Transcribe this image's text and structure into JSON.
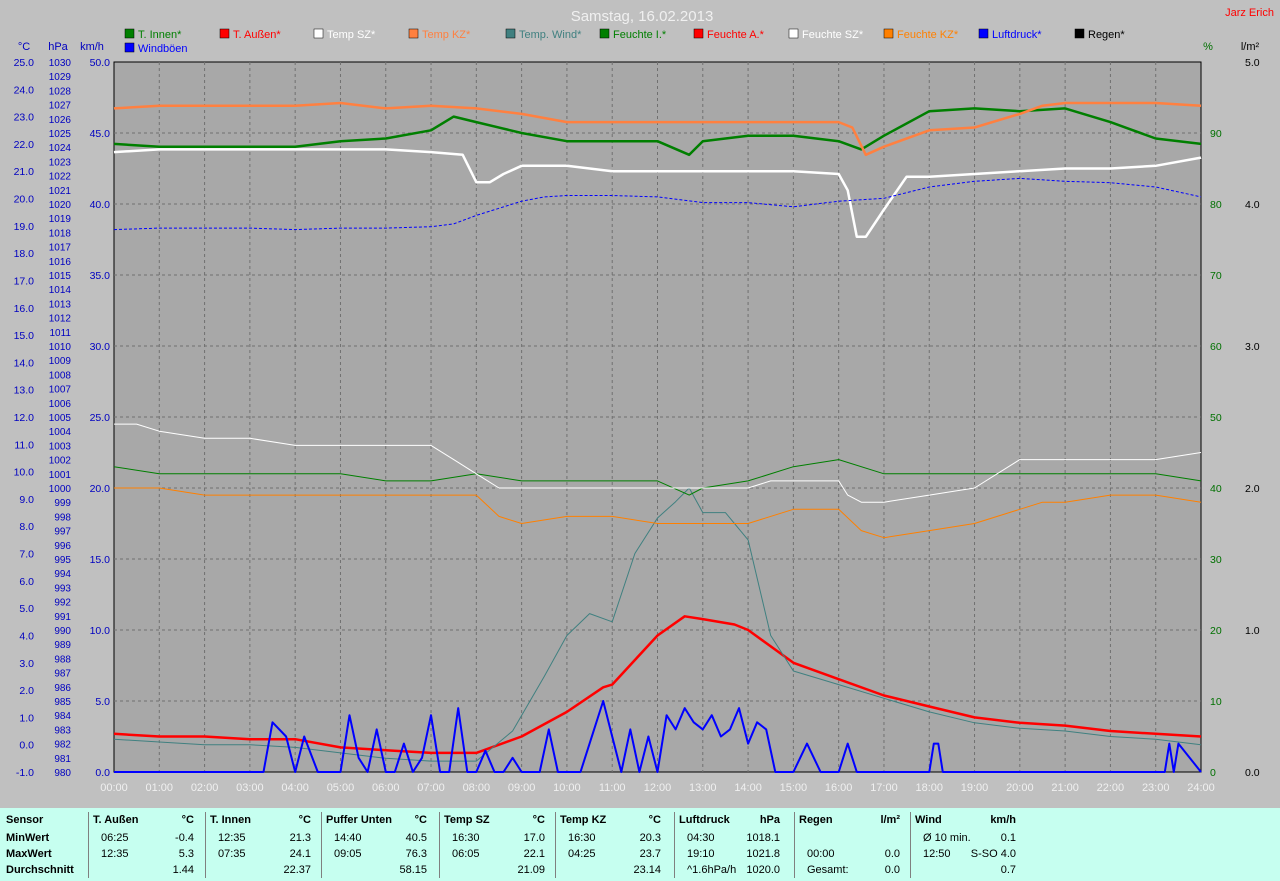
{
  "title": "Samstag, 16.02.2013",
  "author": "Jarz Erich",
  "legend": [
    {
      "label": "T. Innen*",
      "color": "#007f00"
    },
    {
      "label": "T. Außen*",
      "color": "#ff0000"
    },
    {
      "label": "Temp SZ*",
      "color": "#ffffff"
    },
    {
      "label": "Temp KZ*",
      "color": "#ff8040"
    },
    {
      "label": "Temp. Wind*",
      "color": "#408080"
    },
    {
      "label": "Feuchte I.*",
      "color": "#007f00"
    },
    {
      "label": "Feuchte A.*",
      "color": "#ff0000"
    },
    {
      "label": "Feuchte SZ*",
      "color": "#ffffff"
    },
    {
      "label": "Feuchte KZ*",
      "color": "#ff8000"
    },
    {
      "label": "Luftdruck*",
      "color": "#0000ff"
    },
    {
      "label": "Regen*",
      "color": "#000000"
    },
    {
      "label": "Windböen",
      "color": "#0000ff"
    }
  ],
  "axis_units": {
    "temp": "°C",
    "pressure": "hPa",
    "wind": "km/h",
    "humidity": "%",
    "rain": "l/m²"
  },
  "chart_data": {
    "type": "line",
    "x_ticks": [
      "00:00",
      "01:00",
      "02:00",
      "03:00",
      "04:00",
      "05:00",
      "06:00",
      "07:00",
      "08:00",
      "09:00",
      "10:00",
      "11:00",
      "12:00",
      "13:00",
      "14:00",
      "15:00",
      "16:00",
      "17:00",
      "18:00",
      "19:00",
      "20:00",
      "21:00",
      "22:00",
      "23:00",
      "24:00"
    ],
    "temp_axis": {
      "min": -1.0,
      "max": 25.0,
      "step": 1.0
    },
    "pressure_axis": {
      "min": 980,
      "max": 1030,
      "step": 1
    },
    "wind_axis": {
      "min": 0.0,
      "max": 50.0,
      "step": 5.0
    },
    "humidity_axis": {
      "min": 0,
      "max": 100,
      "step": 10
    },
    "rain_axis": {
      "min": 0.0,
      "max": 5.0,
      "step": 1.0
    },
    "grid": true,
    "series": [
      {
        "name": "T. Außen",
        "axis": "temp",
        "color": "#ff0000",
        "width": 2.5,
        "x": [
          0,
          1,
          2,
          3,
          4,
          5,
          6,
          7,
          8,
          9,
          10,
          10.8,
          11,
          11.5,
          12,
          12.6,
          13,
          13.7,
          14,
          15,
          16,
          17,
          18,
          19,
          20,
          21,
          22,
          23,
          24
        ],
        "y": [
          0.4,
          0.3,
          0.3,
          0.2,
          0.2,
          -0.1,
          -0.2,
          -0.3,
          -0.3,
          0.3,
          1.2,
          2.1,
          2.2,
          3.1,
          4.0,
          4.7,
          4.6,
          4.4,
          4.2,
          3.0,
          2.4,
          1.8,
          1.4,
          1.0,
          0.8,
          0.7,
          0.5,
          0.4,
          0.3
        ]
      },
      {
        "name": "Temp. Wind",
        "axis": "temp",
        "color": "#408080",
        "width": 1,
        "x": [
          0,
          1,
          2,
          3,
          4,
          5,
          6,
          7,
          8,
          8.8,
          9.5,
          10,
          10.5,
          11,
          11.5,
          12,
          12.4,
          12.7,
          13,
          13.5,
          14,
          14.5,
          15,
          16,
          17,
          18,
          19,
          20,
          21,
          22,
          23,
          24
        ],
        "y": [
          0.2,
          0.1,
          0.0,
          0.0,
          -0.1,
          -0.3,
          -0.5,
          -0.6,
          -0.6,
          0.5,
          2.5,
          4.0,
          4.8,
          4.5,
          7.0,
          8.3,
          8.9,
          9.4,
          8.5,
          8.5,
          7.5,
          4.0,
          2.7,
          2.2,
          1.7,
          1.2,
          0.8,
          0.6,
          0.5,
          0.3,
          0.2,
          0.0
        ]
      },
      {
        "name": "T. Innen",
        "axis": "temp",
        "color": "#007f00",
        "width": 2.5,
        "x": [
          0,
          1,
          2,
          3,
          4,
          5,
          6,
          7,
          7.5,
          8,
          9,
          10,
          11,
          12,
          12.7,
          13,
          14,
          15,
          16,
          16.5,
          17,
          18,
          19,
          20,
          21,
          22,
          23,
          24
        ],
        "y": [
          22.0,
          21.9,
          21.9,
          21.9,
          21.9,
          22.1,
          22.2,
          22.5,
          23.0,
          22.8,
          22.4,
          22.1,
          22.1,
          22.1,
          21.6,
          22.1,
          22.3,
          22.3,
          22.1,
          21.8,
          22.3,
          23.2,
          23.3,
          23.2,
          23.3,
          22.8,
          22.2,
          22.0
        ]
      },
      {
        "name": "Temp KZ",
        "axis": "temp",
        "color": "#ff8040",
        "width": 2.5,
        "x": [
          0,
          1,
          2,
          3,
          4,
          5,
          6,
          7,
          8,
          9,
          10,
          11,
          12,
          13,
          14,
          15,
          16,
          16.3,
          16.6,
          17,
          18,
          19,
          20,
          20.5,
          21,
          22,
          23,
          24
        ],
        "y": [
          23.3,
          23.4,
          23.4,
          23.4,
          23.4,
          23.5,
          23.3,
          23.4,
          23.3,
          23.1,
          22.8,
          22.8,
          22.8,
          22.8,
          22.8,
          22.8,
          22.8,
          22.6,
          21.6,
          21.9,
          22.5,
          22.6,
          23.1,
          23.4,
          23.5,
          23.5,
          23.5,
          23.4
        ]
      },
      {
        "name": "Temp SZ",
        "axis": "temp",
        "color": "#ffffff",
        "width": 2.5,
        "x": [
          0,
          1,
          2,
          3,
          4,
          5,
          6,
          7,
          7.7,
          8.0,
          8.3,
          8.6,
          9,
          10,
          11,
          12,
          13,
          14,
          15,
          16,
          16.2,
          16.4,
          16.6,
          17,
          17.5,
          18,
          19,
          20,
          21,
          22,
          23,
          24
        ],
        "y": [
          21.7,
          21.8,
          21.8,
          21.8,
          21.8,
          21.8,
          21.8,
          21.7,
          21.6,
          20.6,
          20.6,
          20.9,
          21.2,
          21.2,
          21.0,
          21.0,
          21.0,
          21.0,
          21.0,
          20.9,
          20.3,
          18.6,
          18.6,
          19.6,
          20.8,
          20.8,
          20.9,
          21.0,
          21.1,
          21.1,
          21.2,
          21.5
        ]
      },
      {
        "name": "Luftdruck",
        "axis": "pressure",
        "color": "#0000ff",
        "width": 1,
        "dash": "3,2",
        "x": [
          0,
          1,
          2,
          3,
          4,
          5,
          6,
          7,
          7.5,
          8,
          8.5,
          9,
          9.5,
          10,
          11,
          12,
          13,
          14,
          15,
          16,
          17,
          18,
          19,
          20,
          21,
          22,
          23,
          24
        ],
        "y": [
          1018.2,
          1018.3,
          1018.3,
          1018.3,
          1018.2,
          1018.3,
          1018.3,
          1018.4,
          1018.6,
          1019.2,
          1019.7,
          1020.2,
          1020.5,
          1020.6,
          1020.6,
          1020.5,
          1020.1,
          1020.1,
          1019.8,
          1020.2,
          1020.4,
          1021.2,
          1021.6,
          1021.8,
          1021.6,
          1021.5,
          1021.2,
          1020.5
        ]
      },
      {
        "name": "Feuchte I.",
        "axis": "humidity",
        "color": "#007f00",
        "width": 1,
        "x": [
          0,
          1,
          2,
          3,
          4,
          5,
          6,
          7,
          8,
          9,
          10,
          11,
          12,
          12.7,
          13,
          14,
          15,
          16,
          17,
          18,
          19,
          20,
          21,
          22,
          23,
          24
        ],
        "y": [
          43,
          42,
          42,
          42,
          42,
          42,
          41,
          41,
          42,
          41,
          41,
          41,
          41,
          39,
          40,
          41,
          43,
          44,
          42,
          42,
          42,
          42,
          42,
          42,
          42,
          41
        ]
      },
      {
        "name": "Feuchte SZ",
        "axis": "humidity",
        "color": "#ffffff",
        "width": 1,
        "x": [
          0,
          0.5,
          1,
          2,
          3,
          4,
          5,
          6,
          7,
          7.5,
          8,
          8.5,
          9,
          10,
          11,
          12,
          13,
          14,
          14.5,
          15,
          16,
          16.2,
          16.5,
          17,
          18,
          19,
          20,
          21,
          22,
          23,
          24
        ],
        "y": [
          49,
          49,
          48,
          47,
          47,
          46,
          46,
          46,
          46,
          44,
          42,
          40,
          40,
          40,
          40,
          40,
          40,
          40,
          41,
          41,
          41,
          39,
          38,
          38,
          39,
          40,
          44,
          44,
          44,
          44,
          45
        ]
      },
      {
        "name": "Feuchte KZ",
        "axis": "humidity",
        "color": "#ff8000",
        "width": 1,
        "x": [
          0,
          1,
          2,
          3,
          4,
          5,
          6,
          7,
          8,
          8.5,
          9,
          10,
          11,
          12,
          13,
          14,
          15,
          16,
          16.5,
          17,
          18,
          19,
          20,
          20.5,
          21,
          22,
          23,
          24
        ],
        "y": [
          40,
          40,
          39,
          39,
          39,
          39,
          39,
          39,
          39,
          36,
          35,
          36,
          36,
          35,
          35,
          35,
          37,
          37,
          34,
          33,
          34,
          35,
          37,
          38,
          38,
          39,
          39,
          38
        ]
      },
      {
        "name": "Windböen",
        "axis": "wind",
        "color": "#0000ff",
        "width": 2,
        "x": [
          0,
          3.3,
          3.5,
          3.8,
          4.0,
          4.2,
          4.5,
          5.0,
          5.2,
          5.4,
          5.6,
          5.8,
          6.0,
          6.2,
          6.4,
          6.6,
          6.8,
          7.0,
          7.2,
          7.4,
          7.6,
          7.8,
          8.0,
          8.2,
          8.4,
          8.6,
          8.8,
          9.0,
          9.2,
          9.4,
          9.6,
          9.8,
          10.0,
          10.3,
          10.6,
          10.8,
          11.0,
          11.2,
          11.4,
          11.6,
          11.8,
          12.0,
          12.2,
          12.4,
          12.6,
          12.8,
          13.0,
          13.2,
          13.4,
          13.6,
          13.8,
          14.0,
          14.2,
          14.4,
          14.6,
          14.8,
          15.0,
          15.3,
          15.6,
          15.8,
          16.0,
          16.2,
          16.4,
          18.0,
          18.1,
          18.2,
          18.3,
          23.2,
          23.3,
          23.4,
          23.5,
          24
        ],
        "y": [
          0,
          0,
          3.5,
          2.5,
          0,
          2.5,
          0,
          0,
          4,
          1,
          0,
          3,
          0,
          0,
          2,
          0,
          1,
          4,
          0,
          0,
          4.5,
          0,
          0,
          1.5,
          0,
          0,
          1,
          0,
          0,
          0,
          3,
          0,
          0,
          0,
          3,
          5,
          2.5,
          0,
          3,
          0,
          2.5,
          0,
          4,
          3,
          4.5,
          3.5,
          3,
          4,
          2.5,
          3,
          4.5,
          2,
          3.5,
          3,
          0,
          0,
          0,
          2,
          0,
          0,
          0,
          2,
          0,
          0,
          2,
          2,
          0,
          0,
          2,
          0,
          2,
          0
        ]
      }
    ]
  },
  "stats": {
    "labels": [
      "Sensor",
      "MinWert",
      "MaxWert",
      "Durchschnitt"
    ],
    "columns": [
      {
        "title": "T. Außen",
        "unit": "°C",
        "min_t": "06:25",
        "min_v": "-0.4",
        "max_t": "12:35",
        "max_v": "5.3",
        "avg_t": "",
        "avg_v": "1.44"
      },
      {
        "title": "T. Innen",
        "unit": "°C",
        "min_t": "12:35",
        "min_v": "21.3",
        "max_t": "07:35",
        "max_v": "24.1",
        "avg_t": "",
        "avg_v": "22.37"
      },
      {
        "title": "Puffer Unten",
        "unit": "°C",
        "min_t": "14:40",
        "min_v": "40.5",
        "max_t": "09:05",
        "max_v": "76.3",
        "avg_t": "",
        "avg_v": "58.15"
      },
      {
        "title": "Temp SZ",
        "unit": "°C",
        "min_t": "16:30",
        "min_v": "17.0",
        "max_t": "06:05",
        "max_v": "22.1",
        "avg_t": "",
        "avg_v": "21.09"
      },
      {
        "title": "Temp KZ",
        "unit": "°C",
        "min_t": "16:30",
        "min_v": "20.3",
        "max_t": "04:25",
        "max_v": "23.7",
        "avg_t": "",
        "avg_v": "23.14"
      },
      {
        "title": "Luftdruck",
        "unit": "hPa",
        "min_t": "04:30",
        "min_v": "1018.1",
        "max_t": "19:10",
        "max_v": "1021.8",
        "avg_t": "^1.6hPa/h",
        "avg_v": "1020.0"
      },
      {
        "title": "Regen",
        "unit": "l/m²",
        "min_t": "",
        "min_v": "",
        "max_t": "00:00",
        "max_v": "0.0",
        "avg_t": "Gesamt:",
        "avg_v": "0.0"
      },
      {
        "title": "Wind",
        "unit": "km/h",
        "min_t": "Ø 10 min.",
        "min_v": "0.1",
        "max_t": "12:50",
        "max_v": "S-SO 4.0",
        "avg_t": "",
        "avg_v": "0.7"
      }
    ]
  }
}
